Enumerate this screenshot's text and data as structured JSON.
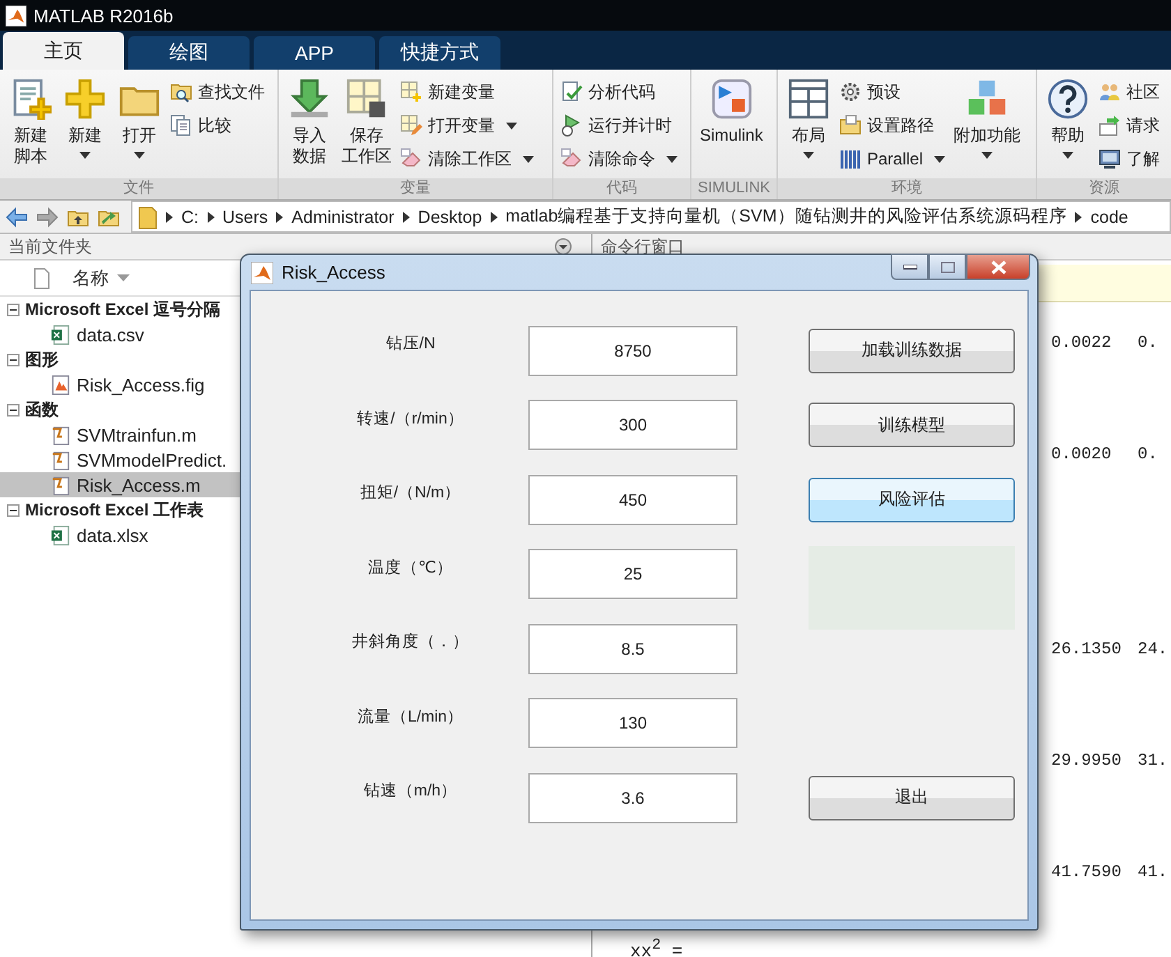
{
  "window": {
    "title": "MATLAB R2016b"
  },
  "tabs": [
    {
      "label": "主页",
      "selected": true
    },
    {
      "label": "绘图",
      "selected": false
    },
    {
      "label": "APP",
      "selected": false
    },
    {
      "label": "快捷方式",
      "selected": false
    }
  ],
  "ribbon": {
    "groups": [
      {
        "label": "文件",
        "controls": [
          {
            "kind": "large",
            "label": [
              "新建",
              "脚本"
            ],
            "dropdown": false
          },
          {
            "kind": "large",
            "label": [
              "新建"
            ],
            "dropdown": true
          },
          {
            "kind": "large",
            "label": [
              "打开"
            ],
            "dropdown": true
          },
          {
            "kind": "stack",
            "items": [
              {
                "label": "查找文件",
                "dropdown": false
              },
              {
                "label": "比较",
                "dropdown": false
              }
            ]
          }
        ]
      },
      {
        "label": "变量",
        "controls": [
          {
            "kind": "large",
            "label": [
              "导入",
              "数据"
            ],
            "dropdown": false
          },
          {
            "kind": "large",
            "label": [
              "保存",
              "工作区"
            ],
            "dropdown": false
          },
          {
            "kind": "stack",
            "items": [
              {
                "label": "新建变量",
                "dropdown": false
              },
              {
                "label": "打开变量",
                "dropdown": true
              },
              {
                "label": "清除工作区",
                "dropdown": true
              }
            ]
          }
        ]
      },
      {
        "label": "代码",
        "controls": [
          {
            "kind": "stack",
            "items": [
              {
                "label": "分析代码",
                "dropdown": false
              },
              {
                "label": "运行并计时",
                "dropdown": false
              },
              {
                "label": "清除命令",
                "dropdown": true
              }
            ]
          }
        ]
      },
      {
        "label": "SIMULINK",
        "controls": [
          {
            "kind": "large",
            "label": [
              "Simulink"
            ],
            "dropdown": false
          }
        ]
      },
      {
        "label": "环境",
        "controls": [
          {
            "kind": "large",
            "label": [
              "布局"
            ],
            "dropdown": true
          },
          {
            "kind": "stack",
            "items": [
              {
                "label": "预设",
                "dropdown": false
              },
              {
                "label": "设置路径",
                "dropdown": false
              },
              {
                "label": "Parallel",
                "dropdown": true
              }
            ]
          },
          {
            "kind": "large",
            "label": [
              "附加功能"
            ],
            "dropdown": true
          }
        ]
      },
      {
        "label": "资源",
        "controls": [
          {
            "kind": "large",
            "label": [
              "帮助"
            ],
            "dropdown": true
          },
          {
            "kind": "stack",
            "items": [
              {
                "label": "社区",
                "dropdown": false
              },
              {
                "label": "请求",
                "dropdown": false
              },
              {
                "label": "了解",
                "dropdown": false
              }
            ]
          }
        ]
      }
    ]
  },
  "address_bar": {
    "segments": [
      "C:",
      "Users",
      "Administrator",
      "Desktop",
      "matlab编程基于支持向量机（SVM）随钻测井的风险评估系统源码程序",
      "code"
    ]
  },
  "current_folder": {
    "title": "当前文件夹",
    "column": "名称",
    "groups": [
      {
        "label": "Microsoft Excel 逗号分隔",
        "expanded": true,
        "children": [
          {
            "name": "data.csv",
            "kind": "excel",
            "selected": false
          }
        ]
      },
      {
        "label": "图形",
        "expanded": true,
        "children": [
          {
            "name": "Risk_Access.fig",
            "kind": "figure",
            "selected": false
          }
        ]
      },
      {
        "label": "函数",
        "expanded": true,
        "children": [
          {
            "name": "SVMtrainfun.m",
            "kind": "function",
            "selected": false
          },
          {
            "name": "SVMmodelPredict.",
            "kind": "function",
            "selected": false
          },
          {
            "name": "Risk_Access.m",
            "kind": "function",
            "selected": true
          }
        ]
      },
      {
        "label": "Microsoft Excel 工作表",
        "expanded": true,
        "children": [
          {
            "name": "data.xlsx",
            "kind": "excel",
            "selected": false
          }
        ]
      }
    ]
  },
  "command_window": {
    "title": "命令行窗口",
    "rows": [
      [
        "0.0022",
        "0."
      ],
      [
        "0.0020",
        "0."
      ],
      [
        "26.1350",
        "24."
      ],
      [
        "29.9950",
        "31."
      ],
      [
        "41.7590",
        "41."
      ]
    ],
    "last_line": "xx$^{2}$ ="
  },
  "dialog": {
    "title": "Risk_Access",
    "fields": [
      {
        "label": "钻压/N",
        "value": "8750"
      },
      {
        "label": "转速/（r/min）",
        "value": "300"
      },
      {
        "label": "扭矩/（N/m）",
        "value": "450"
      },
      {
        "label": "温度（℃）",
        "value": "25"
      },
      {
        "label": "井斜角度（．）",
        "value": "8.5"
      },
      {
        "label": "流量（L/min）",
        "value": "130"
      },
      {
        "label": "钻速（m/h）",
        "value": "3.6"
      }
    ],
    "buttons": [
      {
        "label": "加载训练数据",
        "selected": false
      },
      {
        "label": "训练模型",
        "selected": false
      },
      {
        "label": "风险评估",
        "selected": true
      },
      {
        "label": "退出",
        "selected": false
      }
    ]
  }
}
